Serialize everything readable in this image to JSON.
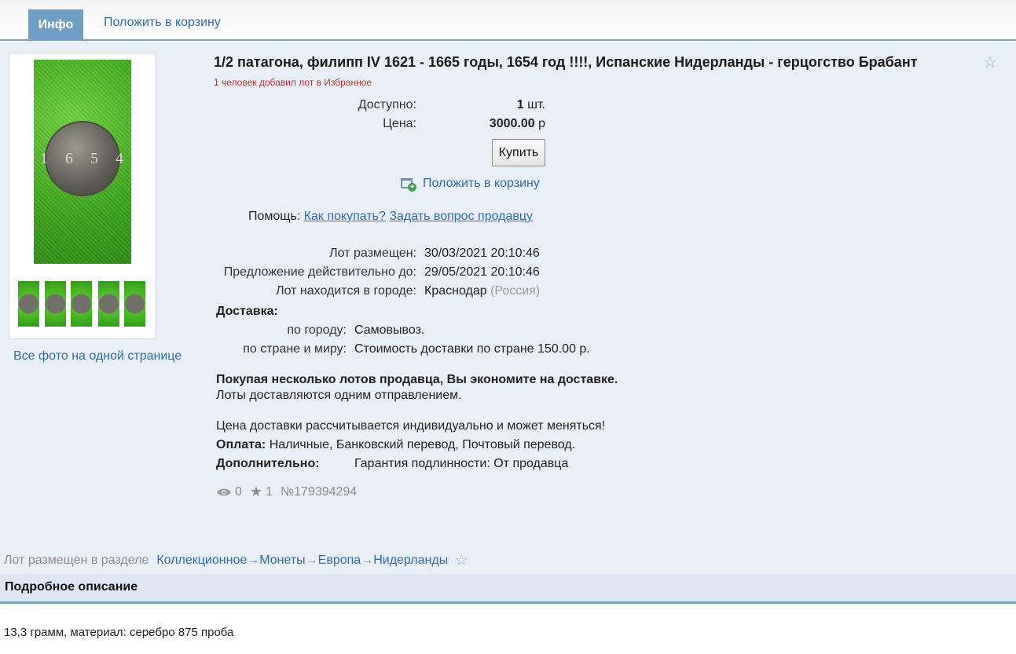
{
  "tabs": {
    "info": "Инфо",
    "add_to_cart": "Положить в корзину"
  },
  "lot": {
    "title": "1/2 патагона, филипп IV 1621 - 1665 годы, 1654 год !!!!, Испанские Нидерланды - герцогство Брабант",
    "fav_note": "1 человек добавил лот в Избранное",
    "available_label": "Доступно:",
    "available_value": "1",
    "available_unit": "шт.",
    "price_label": "Цена:",
    "price_value": "3000.00",
    "price_unit": "р",
    "buy_button": "Купить",
    "cart_link": "Положить в корзину",
    "help_label": "Помощь:",
    "help_link_how": "Как покупать?",
    "help_link_ask": "Задать вопрос продавцу",
    "placed_label": "Лот размещен:",
    "placed_value": "30/03/2021 20:10:46",
    "valid_label": "Предложение действительно до:",
    "valid_value": "29/05/2021 20:10:46",
    "city_label": "Лот находится в городе:",
    "city_value": "Краснодар",
    "country_value": "(Россия)",
    "delivery_label": "Доставка:",
    "city_delivery_label": "по городу:",
    "city_delivery_value": "Самовывоз.",
    "world_delivery_label": "по стране и миру:",
    "world_delivery_value": "Стоимость доставки по стране 150.00 р.",
    "save_note_bold": "Покупая несколько лотов продавца, Вы экономите на доставке.",
    "save_note": "Лоты доставляются одним отправлением.",
    "delivery_calc_note": "Цена доставки рассчитывается индивидуально и может меняться!",
    "payment_label": "Оплата:",
    "payment_value": "Наличные, Банковский перевод, Почтовый перевод.",
    "extra_label": "Дополнительно:",
    "extra_value": "Гарантия подлинности: От продавца",
    "views": "0",
    "stars": "1",
    "lot_number": "№179394294"
  },
  "photos": {
    "all_photos_link": "Все фото на одной странице",
    "coin_text": "1654",
    "thumb_count": 5
  },
  "breadcrumb": {
    "prefix": "Лот размещен в разделе",
    "items": [
      "Коллекционное",
      "Монеты",
      "Европа",
      "Нидерланды"
    ],
    "arrow": "→"
  },
  "description": {
    "title": "Подробное описание",
    "text": "13,3 грамм, материал: серебро 875 проба"
  },
  "colors": {
    "accent": "#6f9ec7",
    "link": "#2b6cb0",
    "panel": "#e9eff7",
    "fav": "#c0312b"
  },
  "icons": {
    "star": "star-icon",
    "eye": "eye-icon",
    "cart": "cart-add-icon"
  }
}
